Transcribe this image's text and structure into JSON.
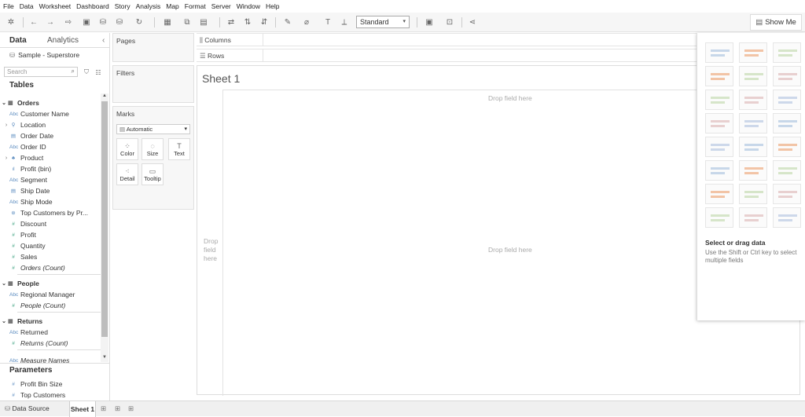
{
  "menu": [
    "File",
    "Data",
    "Worksheet",
    "Dashboard",
    "Story",
    "Analysis",
    "Map",
    "Format",
    "Server",
    "Window",
    "Help"
  ],
  "toolbar": {
    "fit_select": "Standard",
    "show_me_label": "Show Me"
  },
  "data_pane": {
    "tab_data": "Data",
    "tab_analytics": "Analytics",
    "datasource": "Sample - Superstore",
    "search_placeholder": "Search",
    "tables_heading": "Tables",
    "tables": [
      {
        "name": "Orders",
        "fields": [
          {
            "type": "Abc",
            "label": "Customer Name"
          },
          {
            "type": "geo",
            "label": "Location",
            "expand": true
          },
          {
            "type": "date",
            "label": "Order Date"
          },
          {
            "type": "Abc",
            "label": "Order ID"
          },
          {
            "type": "hier",
            "label": "Product",
            "expand": true
          },
          {
            "type": "bin",
            "label": "Profit (bin)"
          },
          {
            "type": "Abc",
            "label": "Segment"
          },
          {
            "type": "date",
            "label": "Ship Date"
          },
          {
            "type": "Abc",
            "label": "Ship Mode"
          },
          {
            "type": "set",
            "label": "Top Customers by Pr..."
          },
          {
            "type": "#",
            "label": "Discount",
            "measure": true
          },
          {
            "type": "#",
            "label": "Profit",
            "measure": true
          },
          {
            "type": "#",
            "label": "Quantity",
            "measure": true
          },
          {
            "type": "#",
            "label": "Sales",
            "measure": true
          },
          {
            "type": "#",
            "label": "Orders (Count)",
            "measure": true,
            "italic": true
          }
        ]
      },
      {
        "name": "People",
        "fields": [
          {
            "type": "Abc",
            "label": "Regional Manager"
          },
          {
            "type": "#",
            "label": "People (Count)",
            "measure": true,
            "italic": true
          }
        ]
      },
      {
        "name": "Returns",
        "fields": [
          {
            "type": "Abc",
            "label": "Returned"
          },
          {
            "type": "#",
            "label": "Returns (Count)",
            "measure": true,
            "italic": true
          }
        ]
      }
    ],
    "measure_names": "Measure Names",
    "parameters_heading": "Parameters",
    "parameters": [
      "Profit Bin Size",
      "Top Customers"
    ]
  },
  "cards": {
    "pages": "Pages",
    "filters": "Filters",
    "marks": "Marks",
    "marks_type": "Automatic",
    "mark_buttons": [
      {
        "label": "Color",
        "icon": "⁘"
      },
      {
        "label": "Size",
        "icon": "◌"
      },
      {
        "label": "Text",
        "icon": "T"
      },
      {
        "label": "Detail",
        "icon": "⁖"
      },
      {
        "label": "Tooltip",
        "icon": "▭"
      }
    ]
  },
  "shelves": {
    "columns": "Columns",
    "rows": "Rows"
  },
  "sheet": {
    "title": "Sheet 1",
    "drop_top": "Drop field here",
    "drop_center": "Drop field here",
    "drop_left": "Drop field here"
  },
  "show_me": {
    "hint_title": "Select or drag data",
    "hint_body": "Use the Shift or Ctrl key to select multiple fields"
  },
  "bottom": {
    "data_source": "Data Source",
    "sheet_tab": "Sheet 1"
  }
}
